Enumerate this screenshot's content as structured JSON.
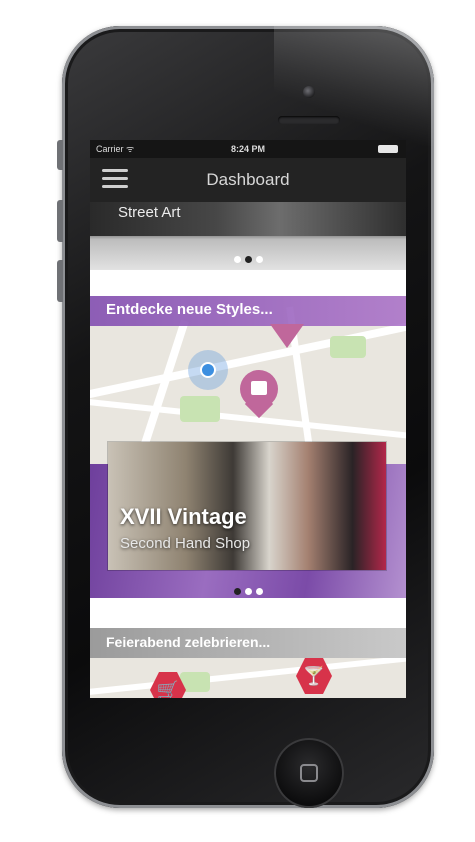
{
  "status_bar": {
    "carrier": "Carrier ᯤ",
    "time": "8:24 PM"
  },
  "nav": {
    "title": "Dashboard"
  },
  "top_card": {
    "label": "Street Art",
    "pager": {
      "count": 3,
      "active": 1
    }
  },
  "discover_card": {
    "title": "Entdecke neue Styles...",
    "shop_name": "XVII Vintage",
    "shop_type": "Second Hand Shop",
    "pager": {
      "count": 3,
      "active": 0
    }
  },
  "evening_card": {
    "title": "Feierabend zelebrieren..."
  },
  "icons": {
    "menu": "hamburger-menu-icon",
    "location": "current-location-icon",
    "shop": "shopping-bag-pin-icon",
    "bar": "cocktail-pin-icon"
  },
  "colors": {
    "purple": "#8552b2",
    "pin_pink": "#c0679b",
    "pin_red": "#d7334a",
    "nav_bg": "#232323"
  }
}
